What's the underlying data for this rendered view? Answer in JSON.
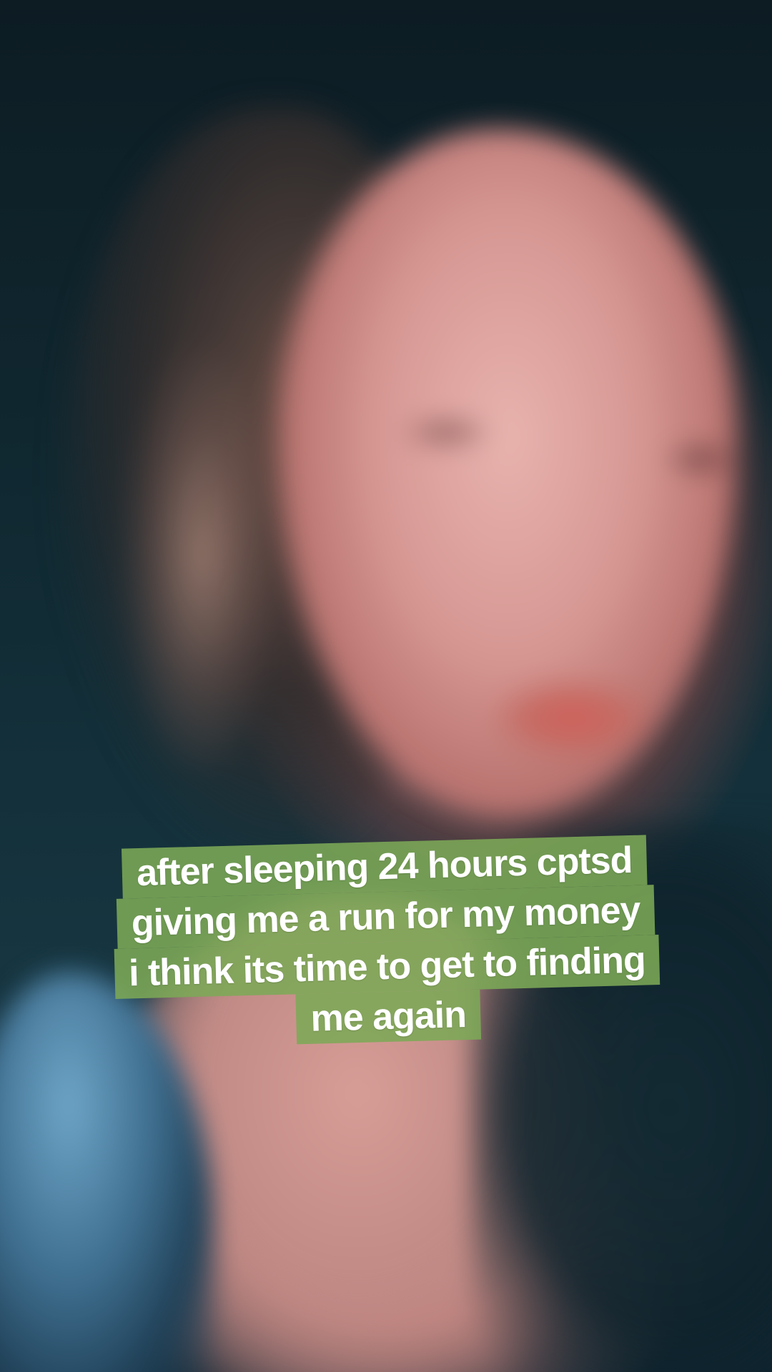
{
  "caption": {
    "lines": [
      "after sleeping 24 hours cptsd",
      "giving me a run for my money",
      "i think its time to get to finding",
      "me again"
    ],
    "background_color": "#7ca856",
    "text_color": "#ffffff"
  }
}
